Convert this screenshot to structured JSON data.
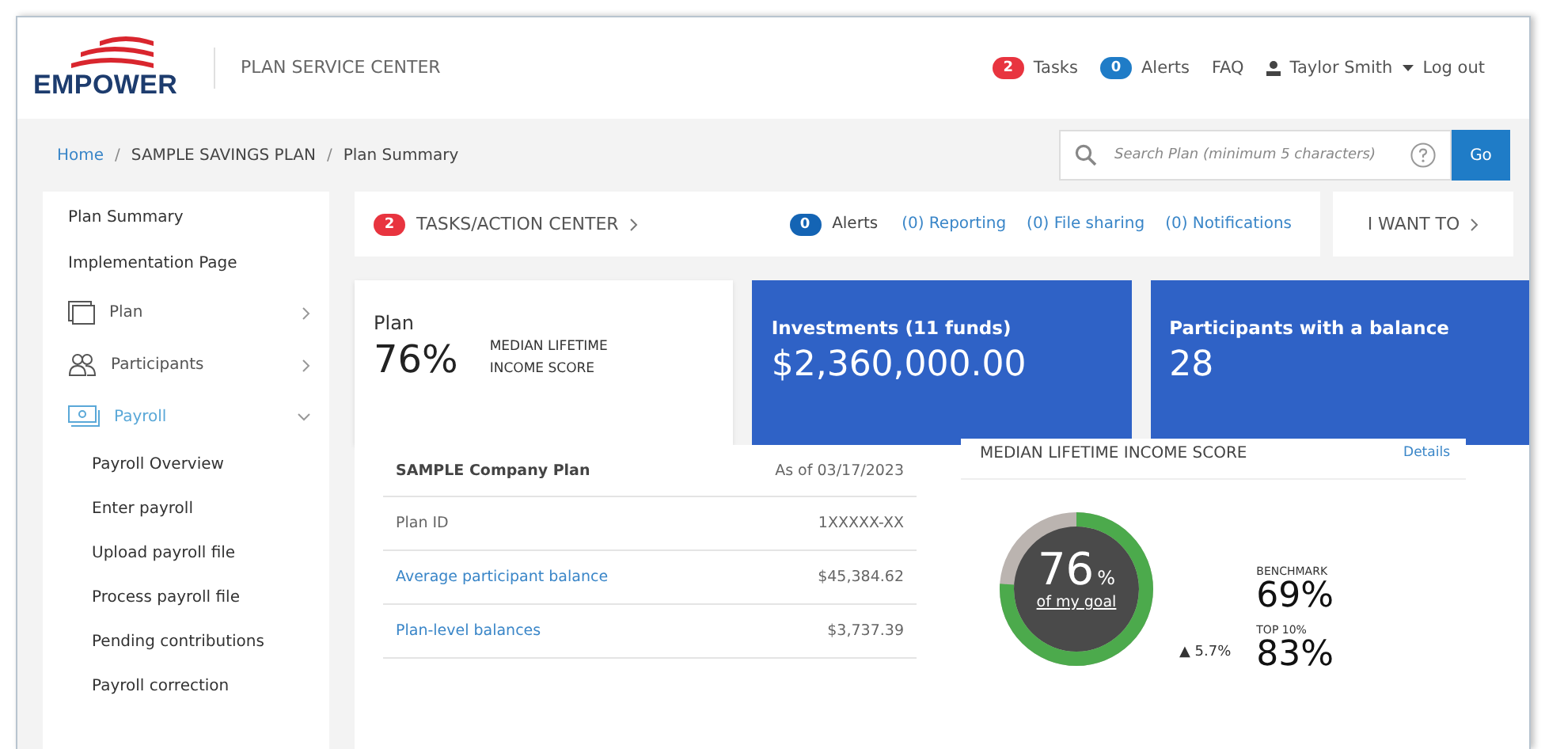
{
  "header": {
    "logo": "EMPOWER",
    "app_title": "PLAN SERVICE CENTER",
    "tasks_count": "2",
    "tasks_label": "Tasks",
    "alerts_count": "0",
    "alerts_label": "Alerts",
    "faq": "FAQ",
    "user": "Taylor Smith",
    "logout": "Log out"
  },
  "breadcrumb": {
    "separator": "/",
    "items": [
      "Home",
      "SAMPLE SAVINGS PLAN",
      "Plan Summary"
    ]
  },
  "search": {
    "placeholder": "Search Plan (minimum 5 characters)",
    "button": "Go"
  },
  "sidebar": {
    "items": [
      {
        "label": "Plan Summary",
        "kind": "link"
      },
      {
        "label": "Implementation Page",
        "kind": "link"
      },
      {
        "label": "Plan",
        "kind": "section",
        "expanded": false,
        "selected": false
      },
      {
        "label": "Participants",
        "kind": "section",
        "expanded": false,
        "selected": false
      },
      {
        "label": "Payroll",
        "kind": "section",
        "expanded": true,
        "selected": true,
        "children": [
          {
            "label": "Payroll Overview"
          },
          {
            "label": "Enter payroll"
          },
          {
            "label": "Upload payroll file"
          },
          {
            "label": "Process payroll file"
          },
          {
            "label": "Pending contributions"
          },
          {
            "label": "Payroll correction"
          }
        ]
      }
    ]
  },
  "action_bar": {
    "tasks_count": "2",
    "tasks_label": "TASKS/ACTION CENTER",
    "alerts_count": "0",
    "alerts_label": "Alerts",
    "links": [
      "(0) Reporting",
      "(0) File sharing",
      "(0) Notifications"
    ],
    "i_want_to": "I WANT TO"
  },
  "cards": [
    {
      "kind": "score",
      "title": "Plan",
      "value": "76%",
      "caption": "MEDIAN LIFETIME INCOME SCORE"
    },
    {
      "kind": "stat",
      "title": "Investments (11 funds)",
      "value": "$2,360,000.00"
    },
    {
      "kind": "stat",
      "title": "Participants with a balance",
      "value": "28"
    }
  ],
  "summary": {
    "name": "SAMPLE Company Plan",
    "date": "As of 03/17/2023",
    "rows": [
      {
        "label": "Plan ID",
        "value": "1XXXXX-XX",
        "link": false
      },
      {
        "label": "Average participant balance",
        "value": "$45,384.62",
        "link": true
      },
      {
        "label": "Plan-level balances",
        "value": "$3,737.39",
        "link": true
      }
    ]
  },
  "score_panel": {
    "title": "MEDIAN LIFETIME INCOME SCORE",
    "details": "Details",
    "gauge": {
      "level": 0.76,
      "value": "76",
      "unit": "%",
      "caption": "of my goal"
    },
    "change": "▲ 5.7%",
    "benchmarks": [
      {
        "label": "BENCHMARK",
        "value": "69%"
      },
      {
        "label": "TOP 10%",
        "value": "83%"
      }
    ]
  }
}
